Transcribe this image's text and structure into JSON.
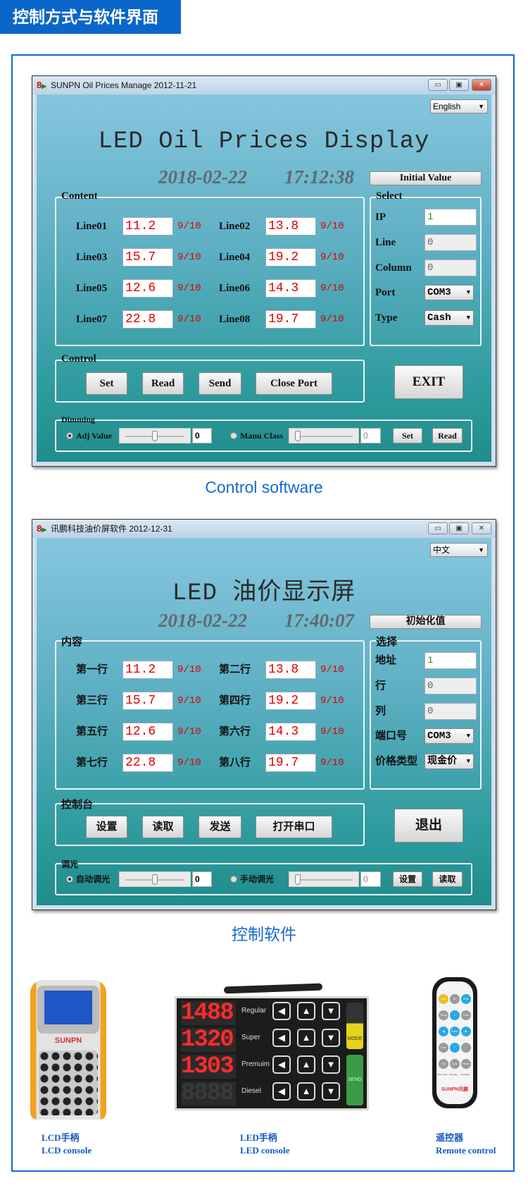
{
  "header": {
    "title": "控制方式与软件界面"
  },
  "windows": [
    {
      "title": "SUNPN Oil Prices Manage 2012-11-21",
      "language": "English",
      "heading": "LED Oil Prices Display",
      "date": "2018-02-22",
      "time": "17:12:38",
      "initial_button": "Initial Value",
      "content_legend": "Content",
      "lines": [
        {
          "label": "Line01",
          "value": "11.2",
          "frac": "9/10"
        },
        {
          "label": "Line02",
          "value": "13.8",
          "frac": "9/10"
        },
        {
          "label": "Line03",
          "value": "15.7",
          "frac": "9/10"
        },
        {
          "label": "Line04",
          "value": "19.2",
          "frac": "9/10"
        },
        {
          "label": "Line05",
          "value": "12.6",
          "frac": "9/10"
        },
        {
          "label": "Line06",
          "value": "14.3",
          "frac": "9/10"
        },
        {
          "label": "Line07",
          "value": "22.8",
          "frac": "9/10"
        },
        {
          "label": "Line08",
          "value": "19.7",
          "frac": "9/10"
        }
      ],
      "select_legend": "Select",
      "select": {
        "ip_label": "IP",
        "ip_value": "1",
        "line_label": "Line",
        "line_value": "0",
        "column_label": "Column",
        "column_value": "0",
        "port_label": "Port",
        "port_value": "COM3",
        "type_label": "Type",
        "type_value": "Cash"
      },
      "control_legend": "Control",
      "control_buttons": [
        "Set",
        "Read",
        "Send",
        "Close Port"
      ],
      "exit_button": "EXIT",
      "dimming_legend": "Dimming",
      "dimming": {
        "auto_label": "Adj Value",
        "auto_value": "0",
        "manual_label": "Manu Class",
        "manual_value": "0",
        "set_button": "Set",
        "read_button": "Read",
        "auto_selected": true
      },
      "caption": "Control software"
    },
    {
      "title": "讯鹏科技油价屏软件 2012-12-31",
      "language": "中文",
      "heading": "LED 油价显示屏",
      "date": "2018-02-22",
      "time": "17:40:07",
      "initial_button": "初始化值",
      "content_legend": "内容",
      "lines": [
        {
          "label": "第一行",
          "value": "11.2",
          "frac": "9/10"
        },
        {
          "label": "第二行",
          "value": "13.8",
          "frac": "9/10"
        },
        {
          "label": "第三行",
          "value": "15.7",
          "frac": "9/10"
        },
        {
          "label": "第四行",
          "value": "19.2",
          "frac": "9/10"
        },
        {
          "label": "第五行",
          "value": "12.6",
          "frac": "9/10"
        },
        {
          "label": "第六行",
          "value": "14.3",
          "frac": "9/10"
        },
        {
          "label": "第七行",
          "value": "22.8",
          "frac": "9/10"
        },
        {
          "label": "第八行",
          "value": "19.7",
          "frac": "9/10"
        }
      ],
      "select_legend": "选择",
      "select": {
        "ip_label": "地址",
        "ip_value": "1",
        "line_label": "行",
        "line_value": "0",
        "column_label": "列",
        "column_value": "0",
        "port_label": "端口号",
        "port_value": "COM3",
        "type_label": "价格类型",
        "type_value": "现金价"
      },
      "control_legend": "控制台",
      "control_buttons": [
        "设置",
        "读取",
        "发送",
        "打开串口"
      ],
      "exit_button": "退出",
      "dimming_legend": "调光",
      "dimming": {
        "auto_label": "自动调光",
        "auto_value": "0",
        "manual_label": "手动调光",
        "manual_value": "0",
        "set_button": "设置",
        "read_button": "读取",
        "auto_selected": true
      },
      "caption": "控制软件"
    }
  ],
  "devices": [
    {
      "name_cn": "LCD手柄",
      "name_en": "LCD console",
      "brand": "SUNPN"
    },
    {
      "name_cn": "LED手柄",
      "name_en": "LED console",
      "rows": [
        {
          "digits": "1488",
          "label": "Regular",
          "lit": true
        },
        {
          "digits": "1320",
          "label": "Super",
          "lit": true
        },
        {
          "digits": "1303",
          "label": "Premuim",
          "lit": true
        },
        {
          "digits": "8888",
          "label": "Diesel",
          "lit": false
        }
      ],
      "mode_key": "MODE",
      "send_key": "SEND"
    },
    {
      "name_cn": "遥控器",
      "name_en": "Remote control",
      "brand": "SUNPN讯鹏",
      "keys": [
        "Esc",
        "ID",
        "Edit",
        "Temp",
        "+",
        "Time",
        "◀",
        "Enter",
        "▶",
        "Line",
        "−",
        "•",
        "Set",
        "Auto",
        "Hand"
      ],
      "key_captions": [
        "Time-zone",
        "Dimming",
        "Dimming"
      ]
    }
  ],
  "colors": {
    "accent": "#0a67c9",
    "price_red": "#dd0000",
    "window_top": "#86c6de",
    "window_bottom": "#208c8c"
  }
}
